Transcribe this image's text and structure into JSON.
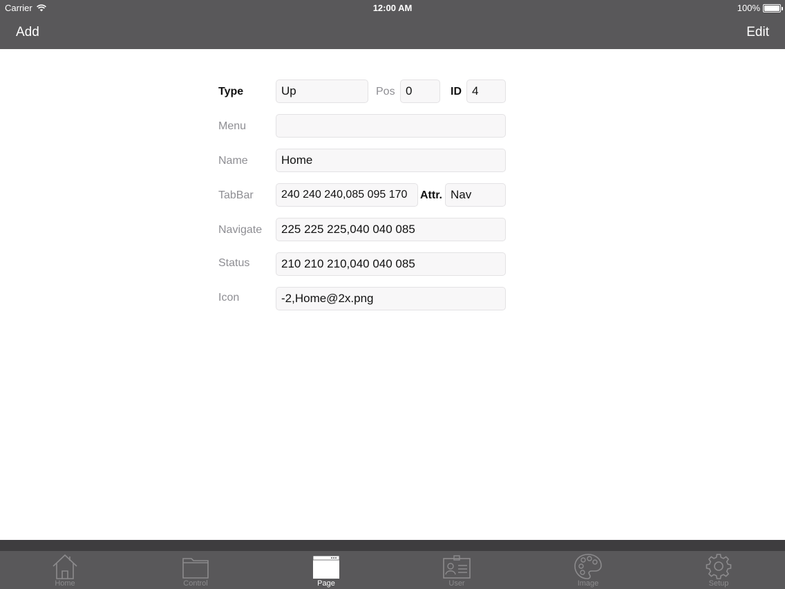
{
  "status_bar": {
    "carrier": "Carrier",
    "time": "12:00 AM",
    "battery": "100%"
  },
  "nav": {
    "left_button": "Add",
    "right_button": "Edit"
  },
  "form": {
    "type_label": "Type",
    "type_value": "Up",
    "pos_label": "Pos",
    "pos_value": "0",
    "id_label": "ID",
    "id_value": "4",
    "menu_label": "Menu",
    "menu_value": "",
    "name_label": "Name",
    "name_value": "Home",
    "tabbar_label": "TabBar",
    "tabbar_value": "240 240 240,085 095 170",
    "attr_label": "Attr.",
    "attr_value": "Nav",
    "navigate_label": "Navigate",
    "navigate_value": "225 225 225,040 040 085",
    "status_label": "Status",
    "status_value": "210 210 210,040 040 085",
    "icon_label": "Icon",
    "icon_value": "-2,Home@2x.png"
  },
  "tabs": [
    {
      "label": "Home",
      "icon": "house-icon",
      "active": false
    },
    {
      "label": "Control",
      "icon": "folder-icon",
      "active": false
    },
    {
      "label": "Page",
      "icon": "page-icon",
      "active": true
    },
    {
      "label": "User",
      "icon": "id-card-icon",
      "active": false
    },
    {
      "label": "Image",
      "icon": "palette-icon",
      "active": false
    },
    {
      "label": "Setup",
      "icon": "gear-icon",
      "active": false
    }
  ],
  "colors": {
    "bar_bg": "#59585a",
    "tab_separator": "#3e3d3f",
    "field_bg": "#f8f7f8",
    "label_gray": "#8e8e93"
  }
}
